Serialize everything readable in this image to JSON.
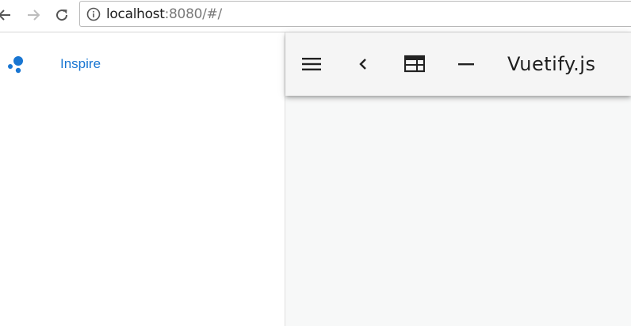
{
  "browser": {
    "url_host": "localhost",
    "url_rest": ":8080/#/",
    "back_icon": "arrow-left-icon",
    "forward_icon": "arrow-right-icon",
    "reload_icon": "reload-icon",
    "info_icon": "info-circle-icon"
  },
  "drawer": {
    "items": [
      {
        "label": "Inspire",
        "icon": "bubble-chart-icon"
      }
    ]
  },
  "toolbar": {
    "title": "Vuetify.js",
    "buttons": [
      {
        "icon": "menu-icon"
      },
      {
        "icon": "chevron-left-icon"
      },
      {
        "icon": "web-icon"
      },
      {
        "icon": "remove-icon"
      }
    ]
  },
  "colors": {
    "accent": "#1976d2",
    "toolbar_bg": "#f5f5f5",
    "content_bg": "#f7f8f8"
  }
}
